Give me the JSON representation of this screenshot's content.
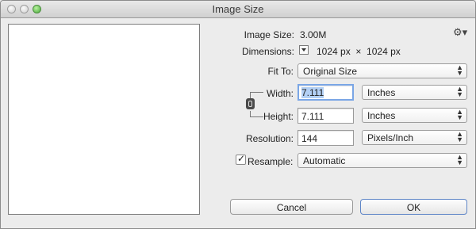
{
  "window": {
    "title": "Image Size"
  },
  "info": {
    "image_size_label": "Image Size:",
    "image_size_value": "3.00M",
    "dimensions_label": "Dimensions:",
    "dimensions_value": "1024 px  ×  1024 px"
  },
  "fit_to": {
    "label": "Fit To:",
    "value": "Original Size"
  },
  "width": {
    "label": "Width:",
    "value": "7.111",
    "unit": "Inches"
  },
  "height": {
    "label": "Height:",
    "value": "7.111",
    "unit": "Inches"
  },
  "resolution": {
    "label": "Resolution:",
    "value": "144",
    "unit": "Pixels/Inch"
  },
  "resample": {
    "label": "Resample:",
    "checked": true,
    "value": "Automatic"
  },
  "buttons": {
    "cancel": "Cancel",
    "ok": "OK"
  },
  "icons": {
    "gear": "gear-icon",
    "link": "chain-link-icon"
  }
}
